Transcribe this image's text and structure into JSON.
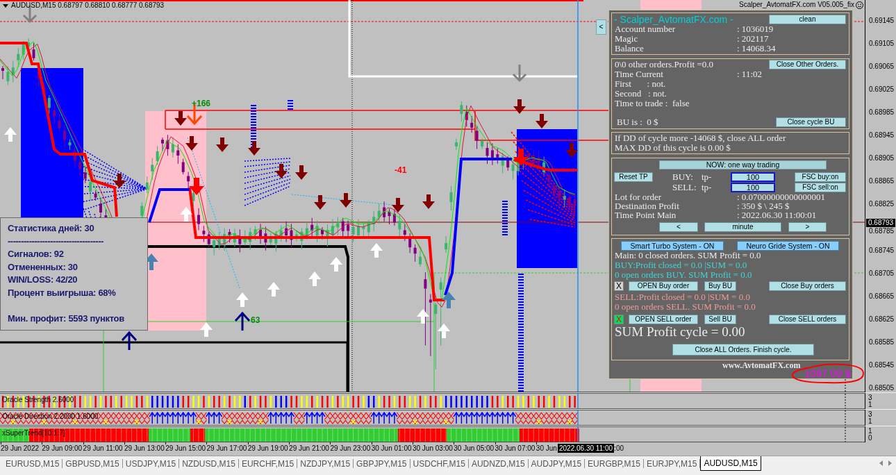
{
  "chart": {
    "title": "AUDUSD,M15 0.68797 0.68810 0.68777 0.68793",
    "expert": "Scalper_AvtomatFX.com V05.005_fix",
    "side_button": "<",
    "labels": [
      {
        "text": "+166",
        "kind": "profit"
      },
      {
        "text": "-41",
        "kind": "loss"
      },
      {
        "text": "63",
        "kind": "profit"
      }
    ],
    "price_ticks": [
      "0.69145",
      "0.69105",
      "0.69065",
      "0.69025",
      "0.68985",
      "0.68945",
      "0.68905",
      "0.68865",
      "0.68825",
      "0.68785",
      "0.68745",
      "0.68705",
      "0.68665",
      "0.68625",
      "0.68585",
      "0.68545",
      "0.68505"
    ],
    "current_price": "0.68793"
  },
  "statistics": {
    "title": "Статистика дней: 30",
    "rule": "------------------------------------",
    "lines": [
      "Сигналов: 92",
      "Отмененных: 30",
      "WIN/LOSS: 42/20",
      "Процент выигрыша: 68%"
    ],
    "footer": "Мин. профит: 5593 пунктов"
  },
  "panel": {
    "account": {
      "title": "- Scalper_AvtomatFX.com -",
      "button": "clean",
      "rows": [
        {
          "label": "Account number",
          "value": ": 1036019"
        },
        {
          "label": "Magic",
          "value": ": 202117"
        },
        {
          "label": "Balance",
          "value": ": 14068.34"
        }
      ]
    },
    "orders": {
      "summary": "0\\0 other orders.Profit =0.0",
      "button": "Close Other Orders.",
      "rows": [
        {
          "label": "Time Current",
          "value": ": 11:02"
        }
      ],
      "lines": [
        "First       : not.",
        "Second   : not.",
        "Time to trade :  false"
      ],
      "bu": "BU is :  0 $",
      "bu_button": "Close cycle BU"
    },
    "drawdown": [
      "If DD of cycle more -14068 $, close ALL order",
      "MAX DD of this cycle is 0.00 $"
    ],
    "trading": {
      "mode": "NOW: one way trading",
      "reset": "Reset TP",
      "sides": [
        {
          "label": "BUY:",
          "tp": "tp-",
          "value": "100",
          "fsc": "FSC buy:on"
        },
        {
          "label": "SELL:",
          "tp": "tp-",
          "value": "100",
          "fsc": "FSC sell:on"
        }
      ],
      "rows": [
        {
          "label": "Lot for order",
          "value": ": 0.07000000000000001"
        },
        {
          "label": "Destination Profit",
          "value": ": 350 $ \\ 245 $"
        },
        {
          "label": "Time Point Main",
          "value": ": 2022.06.30 11:00:01"
        }
      ],
      "nav": [
        "<",
        "minute",
        ">"
      ]
    },
    "systems": {
      "buttons": [
        "Smart Turbo System - ON",
        "Neuro Gride System - ON"
      ],
      "main": "Main: 0 closed orders. SUM Profit = 0.0",
      "sides": [
        {
          "kind": "buy",
          "lines": [
            "BUY:Profit closed = 0.0 |SUM = 0.0",
            "0 open orders BUY. SUM Profit = 0.0"
          ],
          "toggle": {
            "text": "X",
            "active": false
          },
          "buttons": [
            "OPEN Buy order",
            "Buy BU",
            "Close Buy orders"
          ]
        },
        {
          "kind": "sell",
          "lines": [
            "SELL:Profit closed = 0.0 |SUM = 0.0",
            "0 open orders SELL. SUM Profit = 0.0"
          ],
          "toggle": {
            "text": "X",
            "active": true
          },
          "buttons": [
            "OPEN SELL order",
            "Sell BU",
            "Close SELL orders"
          ]
        }
      ],
      "sum": "SUM Profit cycle = 0.00",
      "close_all": "Close ALL Orders. Finish cycle."
    },
    "site": "www.AvtomatFX.com"
  },
  "balance_note": "1097.09 $",
  "indicators": [
    {
      "kind": "strength",
      "name": "Oracle Strength 2.6000",
      "scale": [
        "3",
        "1"
      ]
    },
    {
      "kind": "direction",
      "name": "Oracle Direction 2.2000 1.6000",
      "scale": [
        "3",
        "1"
      ]
    },
    {
      "kind": "supertrend",
      "name": "xSuperTrend[10:1.7]",
      "scale": [
        "1",
        "0"
      ]
    }
  ],
  "time_axis": {
    "labels": [
      "29 Jun 2022",
      "29 Jun 09:00",
      "29 Jun 11:00",
      "29 Jun 13:00",
      "29 Jun 15:00",
      "29 Jun 17:00",
      "29 Jun 19:00",
      "29 Jun 21:00",
      "29 Jun 23:00",
      "30 Jun 01:00",
      "30 Jun 03:00",
      "30 Jun 05:00",
      "30 Jun 07:00",
      "30 Jun"
    ],
    "cursor": "2022.06.30 11:00",
    "tail": ":00"
  },
  "tabs": [
    {
      "label": "EURUSD,M15",
      "selected": false
    },
    {
      "label": "GBPUSD,M15",
      "selected": false
    },
    {
      "label": "USDJPY,M15",
      "selected": false
    },
    {
      "label": "NZDUSD,M15",
      "selected": false
    },
    {
      "label": "EURCHF,M15",
      "selected": false
    },
    {
      "label": "NZDJPY,M15",
      "selected": false
    },
    {
      "label": "GBPJPY,M15",
      "selected": false
    },
    {
      "label": "USDCHF,M15",
      "selected": false
    },
    {
      "label": "AUDNZD,M15",
      "selected": false
    },
    {
      "label": "AUDJPY,M15",
      "selected": false
    },
    {
      "label": "EURGBP,M15",
      "selected": false
    },
    {
      "label": "EURJPY,M15",
      "selected": false
    },
    {
      "label": "AUDUSD,M15",
      "selected": true
    }
  ]
}
